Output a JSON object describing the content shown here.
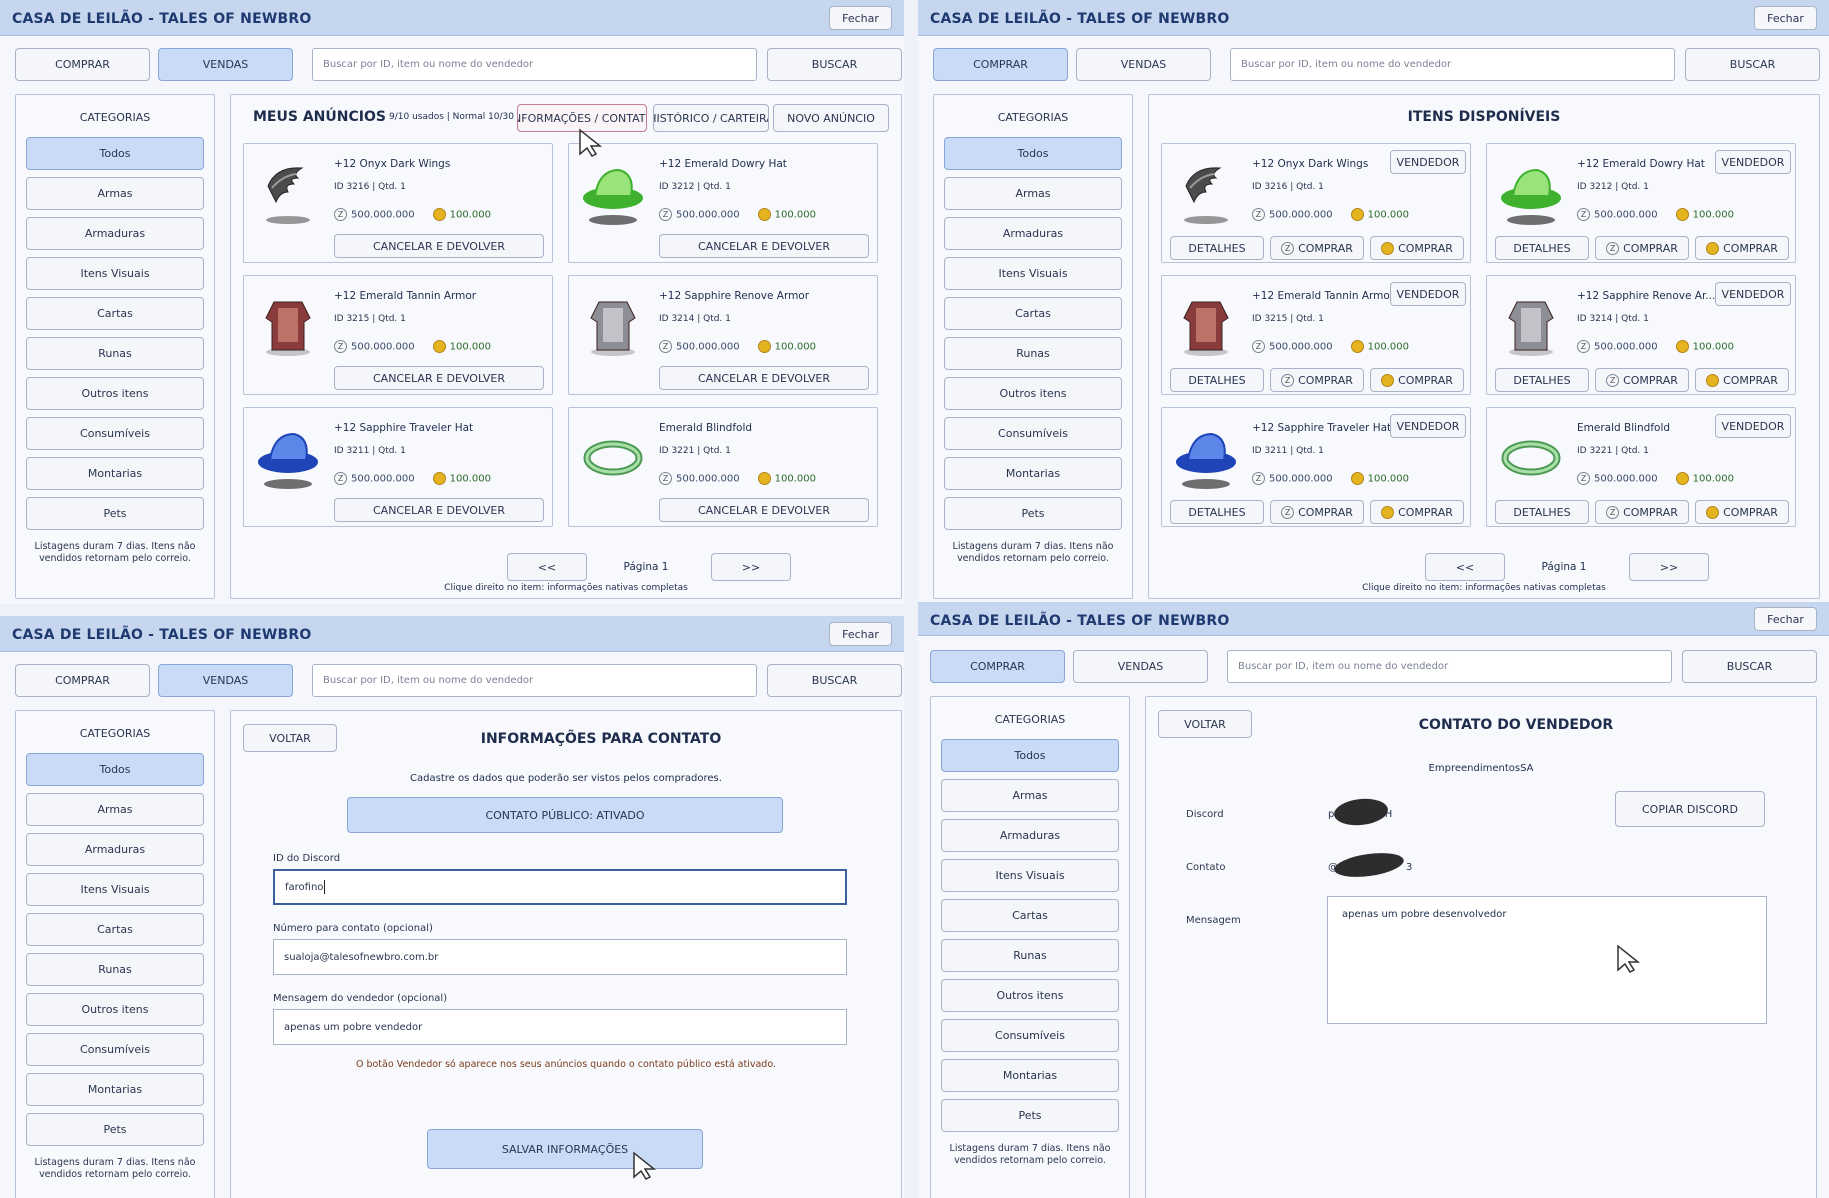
{
  "app": {
    "title": "CASA DE LEILÃO - TALES OF NEWBRO",
    "close_label": "Fechar"
  },
  "nav": {
    "buy_label": "COMPRAR",
    "sell_label": "VENDAS",
    "search_button": "BUSCAR",
    "search_placeholder": "Buscar por ID, item ou nome do vendedor"
  },
  "categories": {
    "heading": "CATEGORIAS",
    "items": [
      "Todos",
      "Armas",
      "Armaduras",
      "Itens Visuais",
      "Cartas",
      "Runas",
      "Outros itens",
      "Consumíveis",
      "Montarias",
      "Pets"
    ],
    "footnote_line1": "Listagens duram 7 dias. Itens não",
    "footnote_line2": "vendidos retornam pelo correio."
  },
  "items": [
    {
      "name": "+12 Onyx Dark Wings",
      "meta": "ID 3216  |  Qtd. 1",
      "zeny": "500.000.000",
      "gold": "100.000",
      "icon": "wings-icon",
      "colors": [
        "#4b4b4b",
        "#9a9a9a"
      ]
    },
    {
      "name": "+12 Emerald Dowry Hat",
      "meta": "ID 3212  |  Qtd. 1",
      "zeny": "500.000.000",
      "gold": "100.000",
      "icon": "hat-icon",
      "colors": [
        "#3fb12f",
        "#9ae37a"
      ]
    },
    {
      "name": "+12 Emerald Tannin Armor",
      "meta": "ID 3215  |  Qtd. 1",
      "zeny": "500.000.000",
      "gold": "100.000",
      "icon": "armor-icon",
      "colors": [
        "#8a3b3b",
        "#d38a7a"
      ]
    },
    {
      "name": "+12 Sapphire Renove Armor",
      "meta": "ID 3214  |  Qtd. 1",
      "zeny": "500.000.000",
      "gold": "100.000",
      "icon": "armor-icon",
      "colors": [
        "#8d8d95",
        "#d9d9df"
      ]
    },
    {
      "name": "+12 Sapphire Traveler Hat",
      "meta": "ID 3211  |  Qtd. 1",
      "zeny": "500.000.000",
      "gold": "100.000",
      "icon": "hat-icon",
      "colors": [
        "#1e44b8",
        "#5c86e8"
      ]
    },
    {
      "name": "Emerald Blindfold",
      "meta": "ID 3221  |  Qtd. 1",
      "zeny": "500.000.000",
      "gold": "100.000",
      "icon": "blindfold-icon",
      "colors": [
        "#4e9a55",
        "#a8e0a8"
      ]
    }
  ],
  "items_available_short": [
    "+12 Onyx Dark Wings",
    "+12 Emerald Dowry Hat",
    "+12 Emerald Tannin Armor",
    "+12 Sapphire Renove Ar...",
    "+12 Sapphire Traveler Hat",
    "Emerald Blindfold"
  ],
  "my_listings": {
    "title": "MEUS ANÚNCIOS",
    "usage": "9/10 usados | Normal 10/30",
    "tab_info": "INFORMAÇÕES / CONTATO",
    "tab_history": "HISTÓRICO / CARTEIRA",
    "tab_new": "NOVO ANÚNCIO",
    "cancel_label": "CANCELAR E DEVOLVER"
  },
  "available": {
    "title": "ITENS DISPONÍVEIS",
    "seller_label": "VENDEDOR",
    "details_label": "DETALHES",
    "buy_label": "COMPRAR"
  },
  "pagination": {
    "prev": "<<",
    "next": ">>",
    "page": "Página 1",
    "hint": "Clique direito no item: informações nativas completas"
  },
  "contact_form": {
    "back_label": "VOLTAR",
    "title": "INFORMAÇÕES PARA CONTATO",
    "subtitle": "Cadastre os dados que poderão ser vistos pelos compradores.",
    "toggle_label": "CONTATO PÚBLICO: ATIVADO",
    "discord_label": "ID do Discord",
    "discord_value": "farofino",
    "phone_label": "Número para contato (opcional)",
    "phone_value": "sualoja@talesofnewbro.com.br",
    "message_label": "Mensagem do vendedor (opcional)",
    "message_value": "apenas um pobre vendedor",
    "note": "O botão Vendedor só aparece nos seus anúncios quando o contato público está ativado.",
    "save_label": "SALVAR INFORMAÇÕES"
  },
  "seller_contact": {
    "back_label": "VOLTAR",
    "title": "CONTATO DO VENDEDOR",
    "seller_name": "EmpreendimentosSA",
    "discord_label": "Discord",
    "discord_prefix": "p",
    "discord_suffix": "0H",
    "contact_label": "Contato",
    "contact_prefix": "@",
    "contact_suffix": "3",
    "message_label": "Mensagem",
    "message_value": "apenas um pobre desenvolvedor",
    "copy_label": "COPIAR DISCORD"
  },
  "colors": {
    "titlebar": "#c7d6ef",
    "active": "#c9dbf6",
    "title_text": "#1e3a70"
  }
}
